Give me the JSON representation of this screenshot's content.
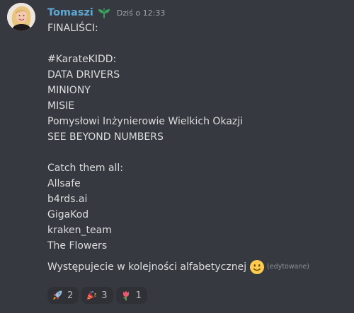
{
  "message": {
    "author": "Tomaszi",
    "badge_icon": "sprout-icon",
    "timestamp": "Dziś o 12:33",
    "lines": [
      "FINALIŚCI:",
      "",
      "#KarateKIDD:",
      "DATA DRIVERS",
      "MINIONY",
      "MISIE",
      "Pomysłowi Inżynierowie Wielkich Okazji",
      "SEE BEYOND NUMBERS",
      "",
      "Catch them all:",
      "Allsafe",
      "b4rds.ai",
      "GigaKod",
      "kraken_team",
      "The Flowers"
    ],
    "last_line": "Występujecie w kolejności alfabetycznej",
    "last_line_emoji": "slightly-smiling-face-icon",
    "edited_label": "(edytowane)"
  },
  "reactions": [
    {
      "icon": "rocket-icon",
      "count": "2"
    },
    {
      "icon": "party-popper-icon",
      "count": "3"
    },
    {
      "icon": "tulip-icon",
      "count": "1"
    }
  ],
  "colors": {
    "background": "#36393f",
    "username": "#5fa8d3",
    "text": "#dcddde",
    "timestamp": "#a3a6aa",
    "reaction_bg": "#2f3136"
  }
}
